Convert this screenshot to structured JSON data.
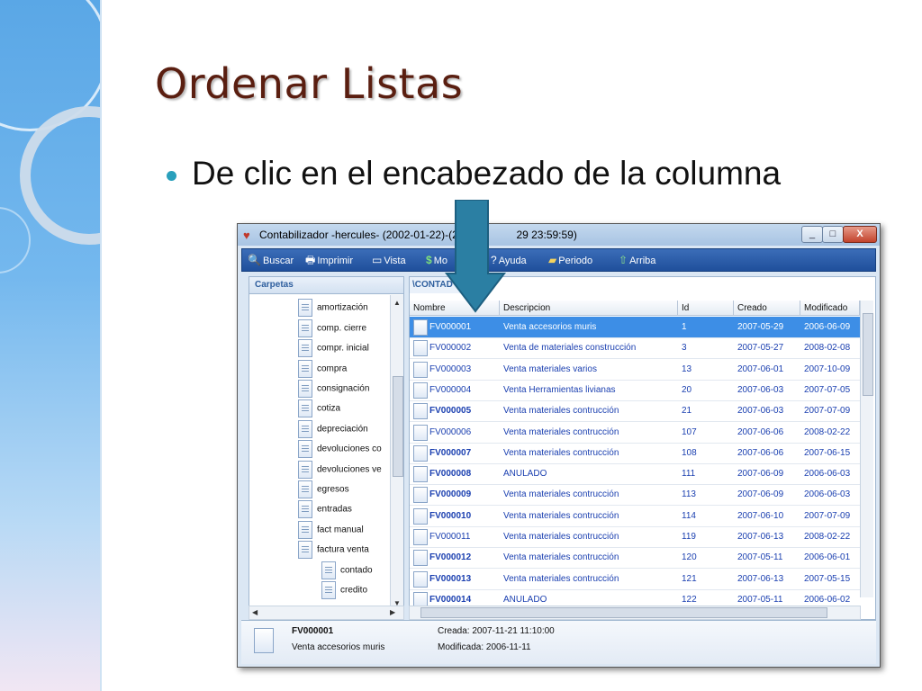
{
  "slide": {
    "title": "Ordenar Listas",
    "bullet": "De clic en el encabezado de la columna"
  },
  "window": {
    "title": "Contabilizador -hercules- (2002-01-22)-(20",
    "title_tail": "29 23:59:59)",
    "min_label": "_",
    "max_label": "□",
    "close_label": "X"
  },
  "toolbar": {
    "buscar": "Buscar",
    "imprimir": "Imprimir",
    "vista": "Vista",
    "moneda": "Mo",
    "ayuda": "Ayuda",
    "periodo": "Periodo",
    "arriba": "Arriba"
  },
  "folders": {
    "tab_label": "Carpetas",
    "items": [
      "amortización",
      "comp. cierre",
      "compr. inicial",
      "compra",
      "consignación",
      "cotiza",
      "depreciación",
      "devoluciones co",
      "devoluciones ve",
      "egresos",
      "entradas",
      "fact manual",
      "factura venta",
      "contado",
      "credito"
    ]
  },
  "list": {
    "tab_label": "\\CONTAD",
    "headers": {
      "nombre": "Nombre",
      "descripcion": "Descripcion",
      "id": "Id",
      "creado": "Creado",
      "modificado": "Modificado"
    },
    "rows": [
      {
        "nombre": "FV000001",
        "descripcion": "Venta accesorios muris",
        "id": "1",
        "creado": "2007-05-29",
        "modificado": "2006-06-09"
      },
      {
        "nombre": "FV000002",
        "descripcion": "Venta de materiales construcción",
        "id": "3",
        "creado": "2007-05-27",
        "modificado": "2008-02-08"
      },
      {
        "nombre": "FV000003",
        "descripcion": "Venta materiales varios",
        "id": "13",
        "creado": "2007-06-01",
        "modificado": "2007-10-09"
      },
      {
        "nombre": "FV000004",
        "descripcion": "Venta Herramientas livianas",
        "id": "20",
        "creado": "2007-06-03",
        "modificado": "2007-07-05"
      },
      {
        "nombre": "FV000005",
        "descripcion": "Venta materiales contrucción",
        "id": "21",
        "creado": "2007-06-03",
        "modificado": "2007-07-09"
      },
      {
        "nombre": "FV000006",
        "descripcion": "Venta materiales contrucción",
        "id": "107",
        "creado": "2007-06-06",
        "modificado": "2008-02-22"
      },
      {
        "nombre": "FV000007",
        "descripcion": "Venta materiales contrucción",
        "id": "108",
        "creado": "2007-06-06",
        "modificado": "2007-06-15"
      },
      {
        "nombre": "FV000008",
        "descripcion": "ANULADO",
        "id": "111",
        "creado": "2007-06-09",
        "modificado": "2006-06-03"
      },
      {
        "nombre": "FV000009",
        "descripcion": "Venta materiales contrucción",
        "id": "113",
        "creado": "2007-06-09",
        "modificado": "2006-06-03"
      },
      {
        "nombre": "FV000010",
        "descripcion": "Venta materiales contrucción",
        "id": "114",
        "creado": "2007-06-10",
        "modificado": "2007-07-09"
      },
      {
        "nombre": "FV000011",
        "descripcion": "Venta materiales contrucción",
        "id": "119",
        "creado": "2007-06-13",
        "modificado": "2008-02-22"
      },
      {
        "nombre": "FV000012",
        "descripcion": "Venta materiales contrucción",
        "id": "120",
        "creado": "2007-05-11",
        "modificado": "2006-06-01"
      },
      {
        "nombre": "FV000013",
        "descripcion": "Venta materiales contrucción",
        "id": "121",
        "creado": "2007-06-13",
        "modificado": "2007-05-15"
      },
      {
        "nombre": "FV000014",
        "descripcion": "ANULADO",
        "id": "122",
        "creado": "2007-05-11",
        "modificado": "2006-06-02"
      }
    ]
  },
  "detail": {
    "name": "FV000001",
    "description": "Venta accesorios muris",
    "created": "Creada: 2007-11-21 11:10:00",
    "modified": "Modificada: 2006-11-11"
  },
  "colors": {
    "title": "#5a1e10",
    "bullet": "#2aa0bc",
    "arrow": "#2b7fa3",
    "selection": "#3d8ee6",
    "toolbar": "#2b5ea8"
  }
}
